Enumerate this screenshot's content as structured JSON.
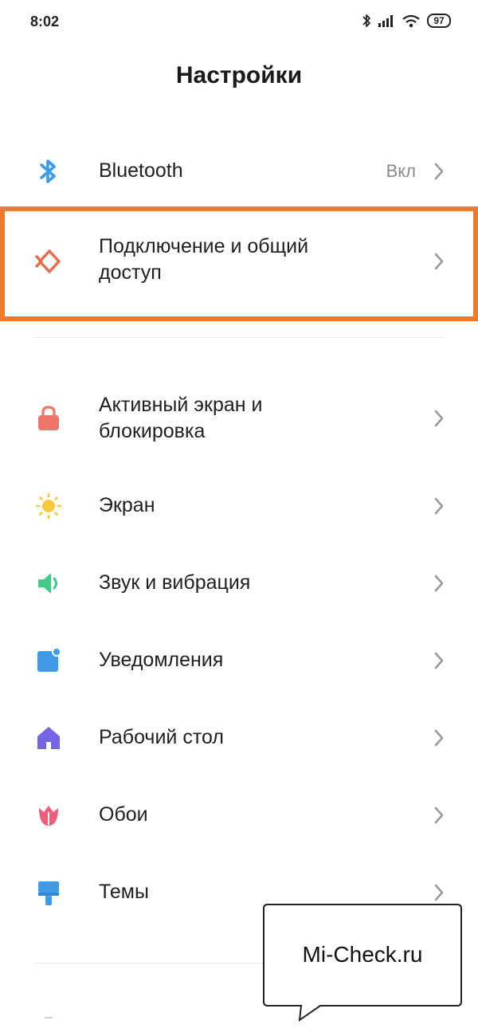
{
  "status_bar": {
    "time": "8:02",
    "battery": "97"
  },
  "header": {
    "title": "Настройки"
  },
  "colors": {
    "highlight": "#f07a2a",
    "bluetooth": "#3d9be9"
  },
  "items": [
    {
      "label": "Bluetooth",
      "value": "Вкл",
      "icon": "bluetooth-icon"
    },
    {
      "label_line1": "Подключение и общий",
      "label_line2": "доступ",
      "icon": "connection-sharing-icon"
    },
    {
      "label_line1": "Активный экран и",
      "label_line2": "блокировка",
      "icon": "lock-icon"
    },
    {
      "label": "Экран",
      "icon": "sun-icon"
    },
    {
      "label": "Звук и вибрация",
      "icon": "speaker-icon"
    },
    {
      "label": "Уведомления",
      "icon": "notification-icon"
    },
    {
      "label": "Рабочий стол",
      "icon": "home-icon"
    },
    {
      "label": "Обои",
      "icon": "wallpaper-flower-icon"
    },
    {
      "label": "Темы",
      "icon": "brush-icon"
    }
  ],
  "watermark": {
    "text": "Mi-Check.ru"
  }
}
